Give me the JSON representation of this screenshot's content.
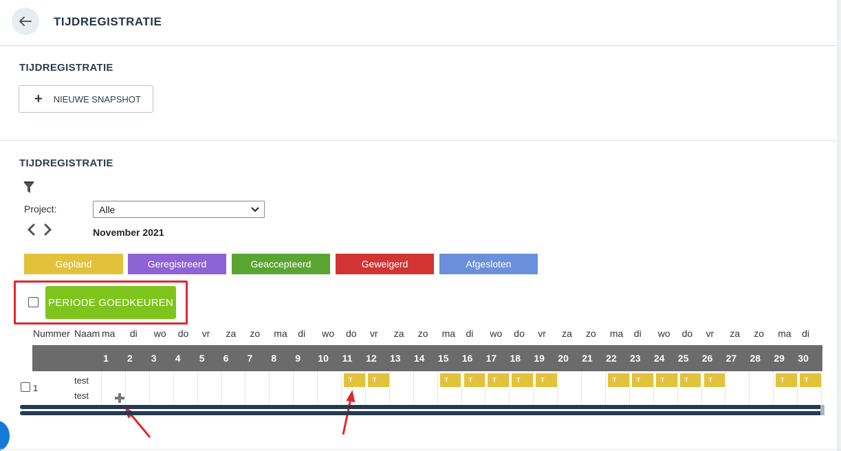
{
  "header": {
    "title": "TIJDREGISTRATIE"
  },
  "snapshot_section": {
    "title": "TIJDREGISTRATIE",
    "new_snapshot_label": "NIEUWE SNAPSHOT"
  },
  "registration_section": {
    "title": "TIJDREGISTRATIE"
  },
  "filter": {
    "project_label": "Project:",
    "project_value": "Alle"
  },
  "calendar": {
    "month": "November 2021"
  },
  "legend": [
    {
      "label": "Gepland",
      "color": "#e2c23a"
    },
    {
      "label": "Geregistreerd",
      "color": "#8e63d6"
    },
    {
      "label": "Geaccepteerd",
      "color": "#5aa531"
    },
    {
      "label": "Geweigerd",
      "color": "#d23434"
    },
    {
      "label": "Afgesloten",
      "color": "#6a8fdb"
    }
  ],
  "approve": {
    "label": "PERIODE GOEDKEUREN"
  },
  "table": {
    "col_number": "Nummer",
    "col_name": "Naam",
    "weekdays": [
      "ma",
      "di",
      "wo",
      "do",
      "vr",
      "za",
      "zo",
      "ma",
      "di",
      "wo",
      "do",
      "vr",
      "za",
      "zo",
      "ma",
      "di",
      "wo",
      "do",
      "vr",
      "za",
      "zo",
      "ma",
      "di",
      "wo",
      "do",
      "vr",
      "za",
      "zo",
      "ma",
      "di"
    ],
    "days": [
      "1",
      "2",
      "3",
      "4",
      "5",
      "6",
      "7",
      "8",
      "9",
      "10",
      "11",
      "12",
      "13",
      "14",
      "15",
      "16",
      "17",
      "18",
      "19",
      "20",
      "21",
      "22",
      "23",
      "24",
      "25",
      "26",
      "27",
      "28",
      "29",
      "30"
    ],
    "rows": [
      {
        "number": "1",
        "name_line1": "test",
        "name_line2": "test",
        "entry_label": "T",
        "entry_days": [
          11,
          12,
          15,
          16,
          17,
          18,
          19,
          22,
          23,
          24,
          25,
          26,
          29,
          30
        ]
      }
    ]
  }
}
